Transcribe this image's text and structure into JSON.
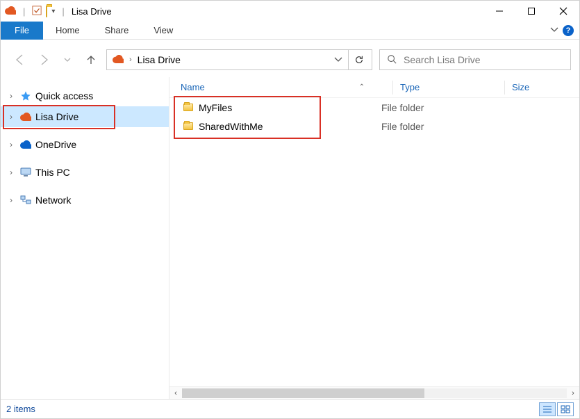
{
  "title": "Lisa Drive",
  "ribbon": {
    "file": "File",
    "tabs": [
      "Home",
      "Share",
      "View"
    ]
  },
  "address": {
    "location": "Lisa Drive"
  },
  "search": {
    "placeholder": "Search Lisa Drive"
  },
  "tree": {
    "items": [
      {
        "label": "Quick access",
        "icon": "star"
      },
      {
        "label": "Lisa Drive",
        "icon": "cloud-orange",
        "selected": true,
        "highlighted": true
      },
      {
        "label": "OneDrive",
        "icon": "onedrive"
      },
      {
        "label": "This PC",
        "icon": "pc"
      },
      {
        "label": "Network",
        "icon": "network"
      }
    ]
  },
  "columns": {
    "name": "Name",
    "type": "Type",
    "size": "Size"
  },
  "rows": [
    {
      "name": "MyFiles",
      "type": "File folder"
    },
    {
      "name": "SharedWithMe",
      "type": "File folder"
    }
  ],
  "status": {
    "text": "2 items"
  },
  "help_char": "?"
}
